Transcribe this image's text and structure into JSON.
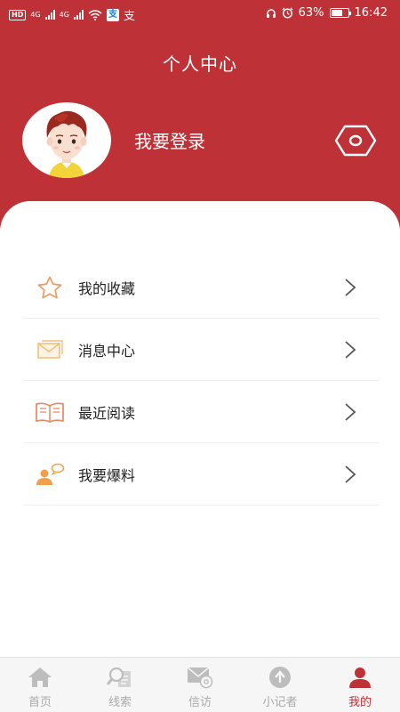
{
  "status_bar": {
    "hd": "HD",
    "net_1": "4G",
    "net_2": "4G",
    "app_badge": "支",
    "extra": "支",
    "battery": "63%",
    "time": "16:42"
  },
  "header": {
    "title": "个人中心",
    "login_label": "我要登录",
    "icons": {
      "avatar": "cartoon-avatar",
      "settings": "hexagon-settings-icon"
    }
  },
  "menu": [
    {
      "label": "我的收藏",
      "icon": "star-icon"
    },
    {
      "label": "消息中心",
      "icon": "envelope-icon"
    },
    {
      "label": "最近阅读",
      "icon": "open-book-icon"
    },
    {
      "label": "我要爆料",
      "icon": "person-speech-icon"
    }
  ],
  "tabs": [
    {
      "label": "首页",
      "icon": "home-icon",
      "active": false
    },
    {
      "label": "线索",
      "icon": "search-clue-icon",
      "active": false
    },
    {
      "label": "信访",
      "icon": "mail-at-icon",
      "active": false
    },
    {
      "label": "小记者",
      "icon": "upload-arrow-icon",
      "active": false
    },
    {
      "label": "我的",
      "icon": "person-icon",
      "active": true
    }
  ],
  "colors": {
    "brand_red": "#be3237",
    "menu_icon_orange": "#e9a06a",
    "tab_inactive": "#aaaaaa"
  }
}
